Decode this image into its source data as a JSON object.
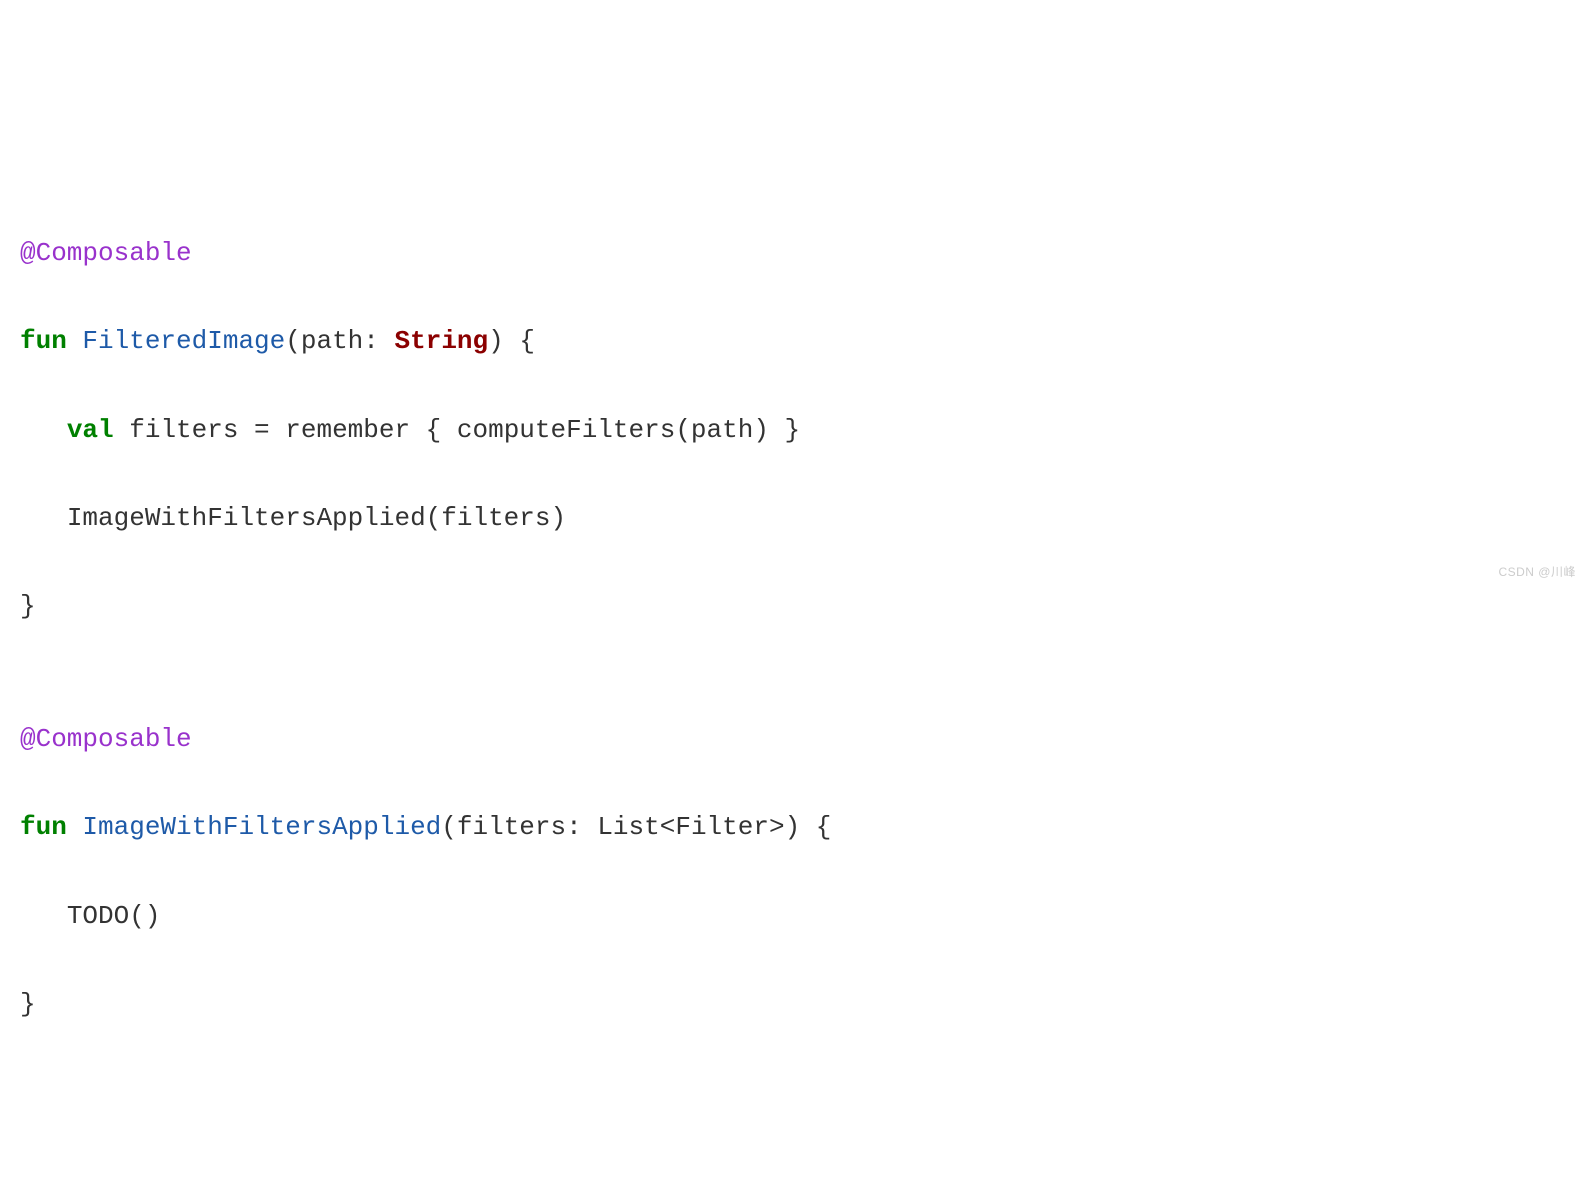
{
  "code": {
    "line1": {
      "annotation": "@Composable"
    },
    "line2": {
      "kw_fun": "fun",
      "funcname": "FilteredImage",
      "lparen": "(",
      "param": "path",
      "colon": ": ",
      "type": "String",
      "rparen_brace": ") {"
    },
    "line3": {
      "indent": "   ",
      "kw_val": "val",
      "sp1": " ",
      "ident": "filters = remember { computeFilters(path) }"
    },
    "line4": {
      "indent": "   ",
      "call": "ImageWithFiltersApplied(filters)"
    },
    "line5": {
      "brace": "}"
    },
    "line6": {
      "blank": ""
    },
    "line7": {
      "annotation": "@Composable"
    },
    "line8": {
      "kw_fun": "fun",
      "funcname": "ImageWithFiltersApplied",
      "lparen": "(",
      "param": "filters",
      "colon": ": ",
      "type_text": "List<Filter>",
      "rparen_brace": ") {"
    },
    "line9": {
      "indent": "   ",
      "call": "TODO()"
    },
    "line10": {
      "brace": "}"
    }
  },
  "watermark": "CSDN @川峰"
}
